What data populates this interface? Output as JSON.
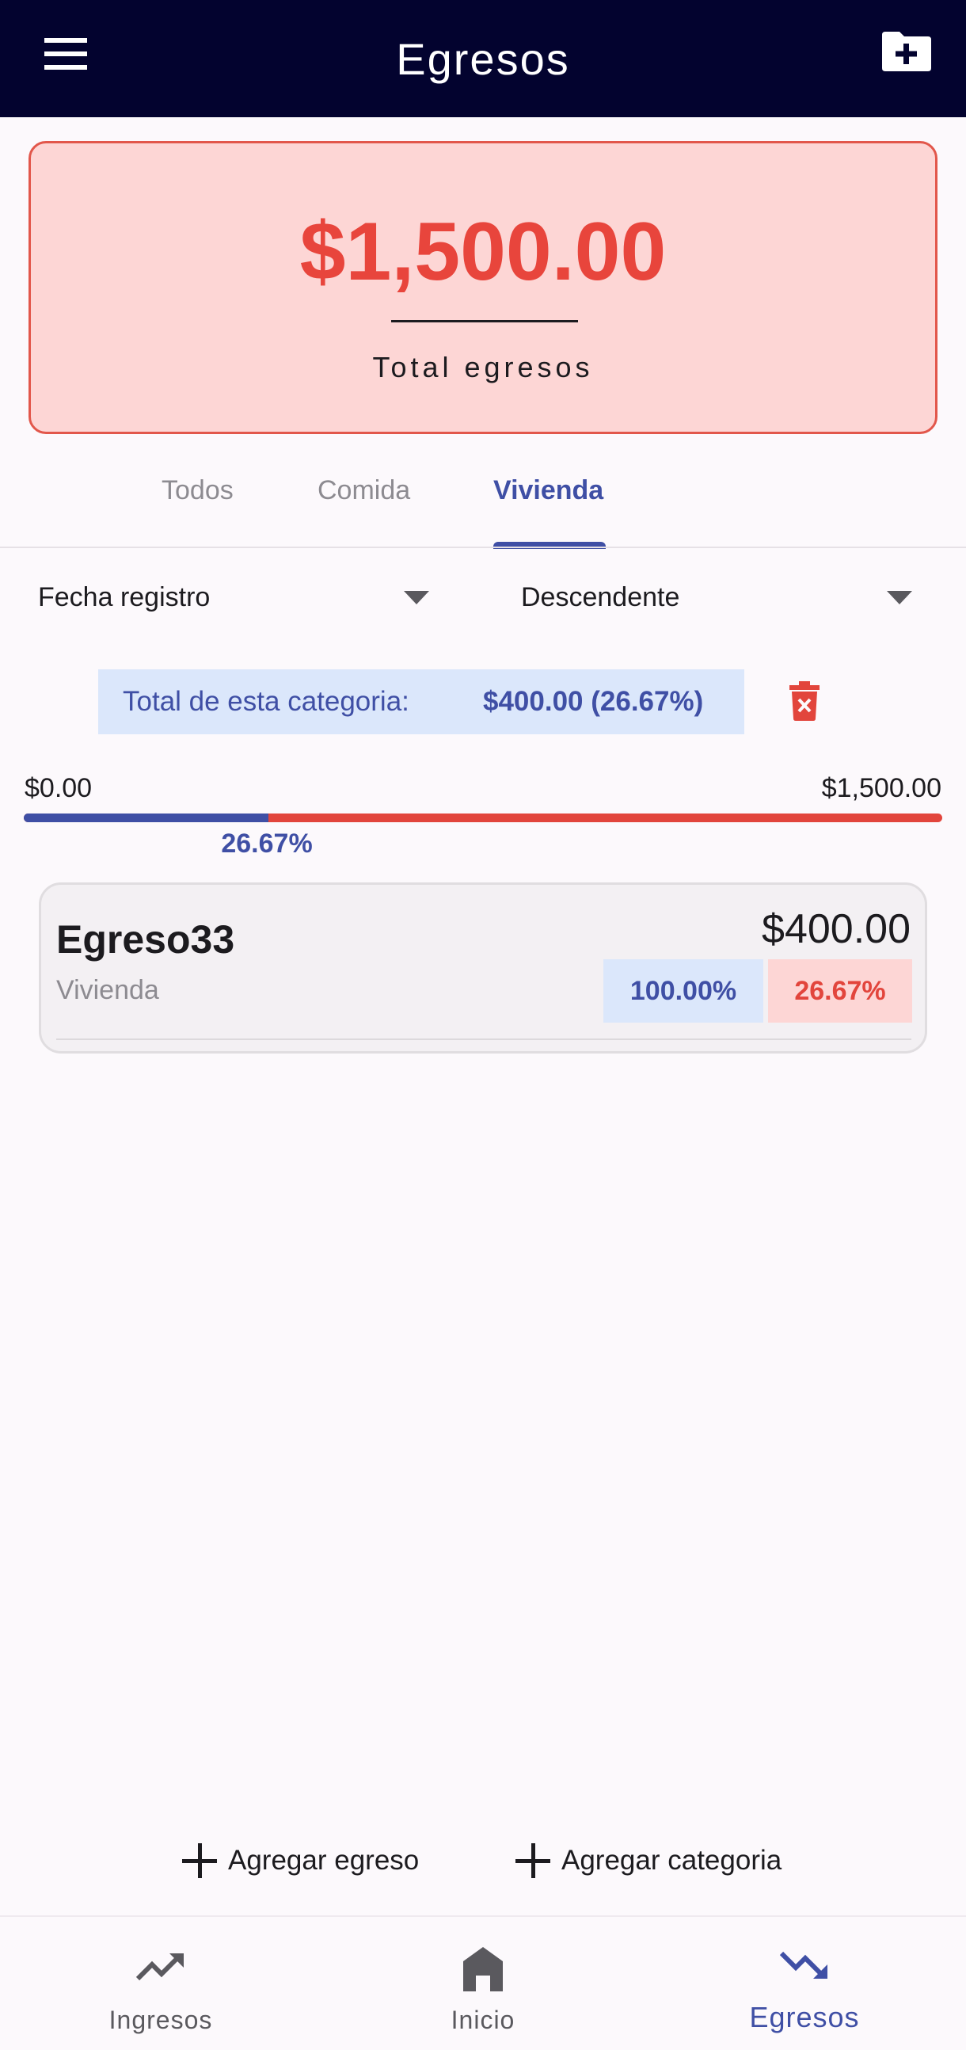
{
  "appbar": {
    "title": "Egresos",
    "menu_icon": "menu-icon",
    "action_icon": "folder-add-icon"
  },
  "summary": {
    "total_amount": "$1,500.00",
    "total_label": "Total egresos"
  },
  "tabs": [
    {
      "label": "Todos",
      "active": false
    },
    {
      "label": "Comida",
      "active": false
    },
    {
      "label": "Vivienda",
      "active": true
    }
  ],
  "filters": {
    "sort_field": "Fecha registro",
    "sort_order": "Descendente"
  },
  "category_total": {
    "label": "Total de esta categoria:",
    "value": "$400.00 (26.67%)",
    "delete_icon": "trash-icon"
  },
  "progress": {
    "min_label": "$0.00",
    "max_label": "$1,500.00",
    "percent_label": "26.67%",
    "fraction": 0.2667
  },
  "expenses": [
    {
      "name": "Egreso33",
      "category": "Vivienda",
      "amount": "$400.00",
      "category_percent": "100.00%",
      "total_percent": "26.67%"
    }
  ],
  "actions": {
    "add_expense": "Agregar egreso",
    "add_category": "Agregar categoria"
  },
  "nav": [
    {
      "label": "Ingresos",
      "icon": "trending-up-icon",
      "active": false
    },
    {
      "label": "Inicio",
      "icon": "home-icon",
      "active": false
    },
    {
      "label": "Egresos",
      "icon": "trending-down-icon",
      "active": true
    }
  ],
  "colors": {
    "appbar": "#03032f",
    "accent_blue": "#3f4fa5",
    "accent_red": "#e2453c",
    "card_red_bg": "#fdd6d5",
    "card_blue_bg": "#dbe7fb"
  }
}
